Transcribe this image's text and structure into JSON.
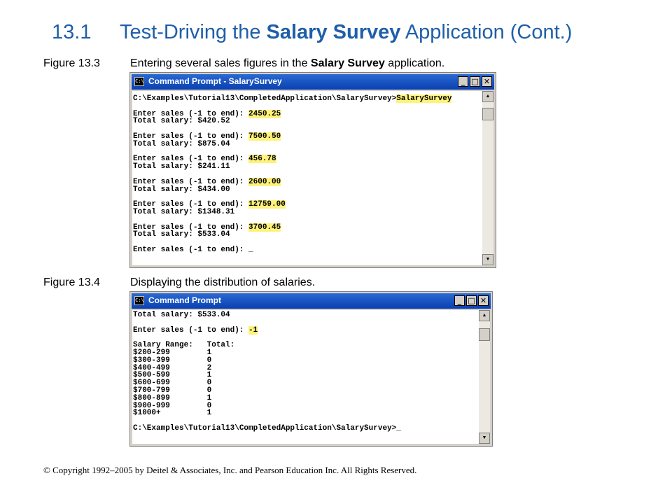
{
  "header": {
    "number": "13.1",
    "title_pre": "Test-Driving the ",
    "title_bold": "Salary Survey",
    "title_post": " Application (Cont.)"
  },
  "figure1": {
    "label": "Figure 13.3",
    "caption_pre": "Entering several sales figures in the ",
    "caption_bold": "Salary Survey",
    "caption_post": " application."
  },
  "figure2": {
    "label": "Figure 13.4",
    "caption": "Displaying the distribution of salaries."
  },
  "window1": {
    "title": "Command Prompt - SalarySurvey",
    "icon_text": "C:\\",
    "minimize": "_",
    "maximize": "□",
    "close": "✕",
    "prompt": "C:\\Examples\\Tutorial13\\CompletedApplication\\SalarySurvey>",
    "command": "SalarySurvey",
    "entries": [
      {
        "prompt": "Enter sales (-1 to end): ",
        "input": "2450.25",
        "result": "Total salary: $420.52"
      },
      {
        "prompt": "Enter sales (-1 to end): ",
        "input": "7500.50",
        "result": "Total salary: $875.04"
      },
      {
        "prompt": "Enter sales (-1 to end): ",
        "input": "456.78",
        "result": "Total salary: $241.11"
      },
      {
        "prompt": "Enter sales (-1 to end): ",
        "input": "2600.00",
        "result": "Total salary: $434.00"
      },
      {
        "prompt": "Enter sales (-1 to end): ",
        "input": "12759.00",
        "result": "Total salary: $1348.31"
      },
      {
        "prompt": "Enter sales (-1 to end): ",
        "input": "3700.45",
        "result": "Total salary: $533.04"
      }
    ],
    "last_prompt": "Enter sales (-1 to end): ",
    "cursor": "_"
  },
  "window2": {
    "title": "Command Prompt",
    "icon_text": "C:\\",
    "minimize": "_",
    "maximize": "□",
    "close": "✕",
    "first_line": "Total salary: $533.04",
    "sentinel_prompt": "Enter sales (-1 to end): ",
    "sentinel_input": "-1",
    "table_header": "Salary Range:   Total:",
    "ranges": [
      {
        "range": "$200-299",
        "total": "1"
      },
      {
        "range": "$300-399",
        "total": "0"
      },
      {
        "range": "$400-499",
        "total": "2"
      },
      {
        "range": "$500-599",
        "total": "1"
      },
      {
        "range": "$600-699",
        "total": "0"
      },
      {
        "range": "$700-799",
        "total": "0"
      },
      {
        "range": "$800-899",
        "total": "1"
      },
      {
        "range": "$900-999",
        "total": "0"
      },
      {
        "range": "$1000+",
        "total": "1"
      }
    ],
    "final_prompt": "C:\\Examples\\Tutorial13\\CompletedApplication\\SalarySurvey>",
    "cursor": "_"
  },
  "footer": {
    "copyright": "© Copyright 1992–2005 by Deitel & Associates, Inc. and Pearson Education Inc. All Rights Reserved."
  },
  "colors": {
    "title": "#1f5fa8",
    "titlebar": "#0a3fb0",
    "highlight": "#fff27a"
  }
}
